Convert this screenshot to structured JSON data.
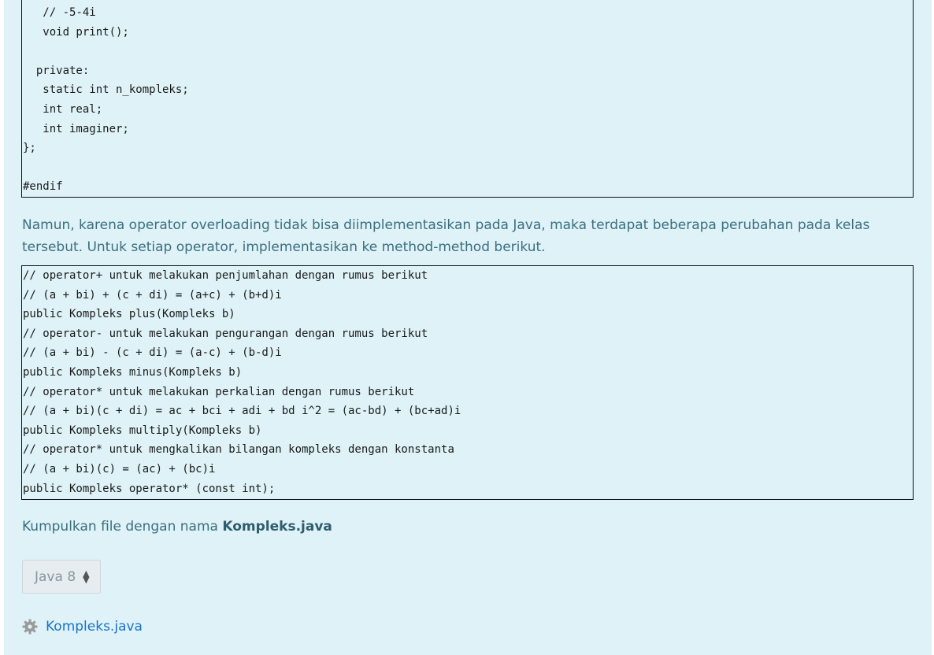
{
  "code_top": "   // -5-4i\n   void print();\n\n  private:\n   static int n_kompleks;\n   int real;\n   int imaginer;\n};\n\n#endif",
  "paragraph": "Namun, karena operator overloading tidak bisa diimplementasikan pada Java, maka terdapat beberapa perubahan pada kelas tersebut. Untuk setiap operator, implementasikan ke method-method berikut.",
  "code_bottom": "// operator+ untuk melakukan penjumlahan dengan rumus berikut\n// (a + bi) + (c + di) = (a+c) + (b+d)i\npublic Kompleks plus(Kompleks b)\n// operator- untuk melakukan pengurangan dengan rumus berikut\n// (a + bi) - (c + di) = (a-c) + (b-d)i\npublic Kompleks minus(Kompleks b)\n// operator* untuk melakukan perkalian dengan rumus berikut\n// (a + bi)(c + di) = ac + bci + adi + bd i^2 = (ac-bd) + (bc+ad)i\npublic Kompleks multiply(Kompleks b)\n// operator* untuk mengkalikan bilangan kompleks dengan konstanta\n// (a + bi)(c) = (ac) + (bc)i\npublic Kompleks operator* (const int);",
  "submit_text_prefix": "Kumpulkan file dengan nama ",
  "submit_filename": "Kompleks.java",
  "language_select": {
    "selected": "Java 8"
  },
  "file_link": {
    "label": "Kompleks.java",
    "icon": "gear-icon"
  },
  "colors": {
    "panel_bg": "#def2f8",
    "text": "#3b6e7e",
    "link": "#1a73c9"
  }
}
